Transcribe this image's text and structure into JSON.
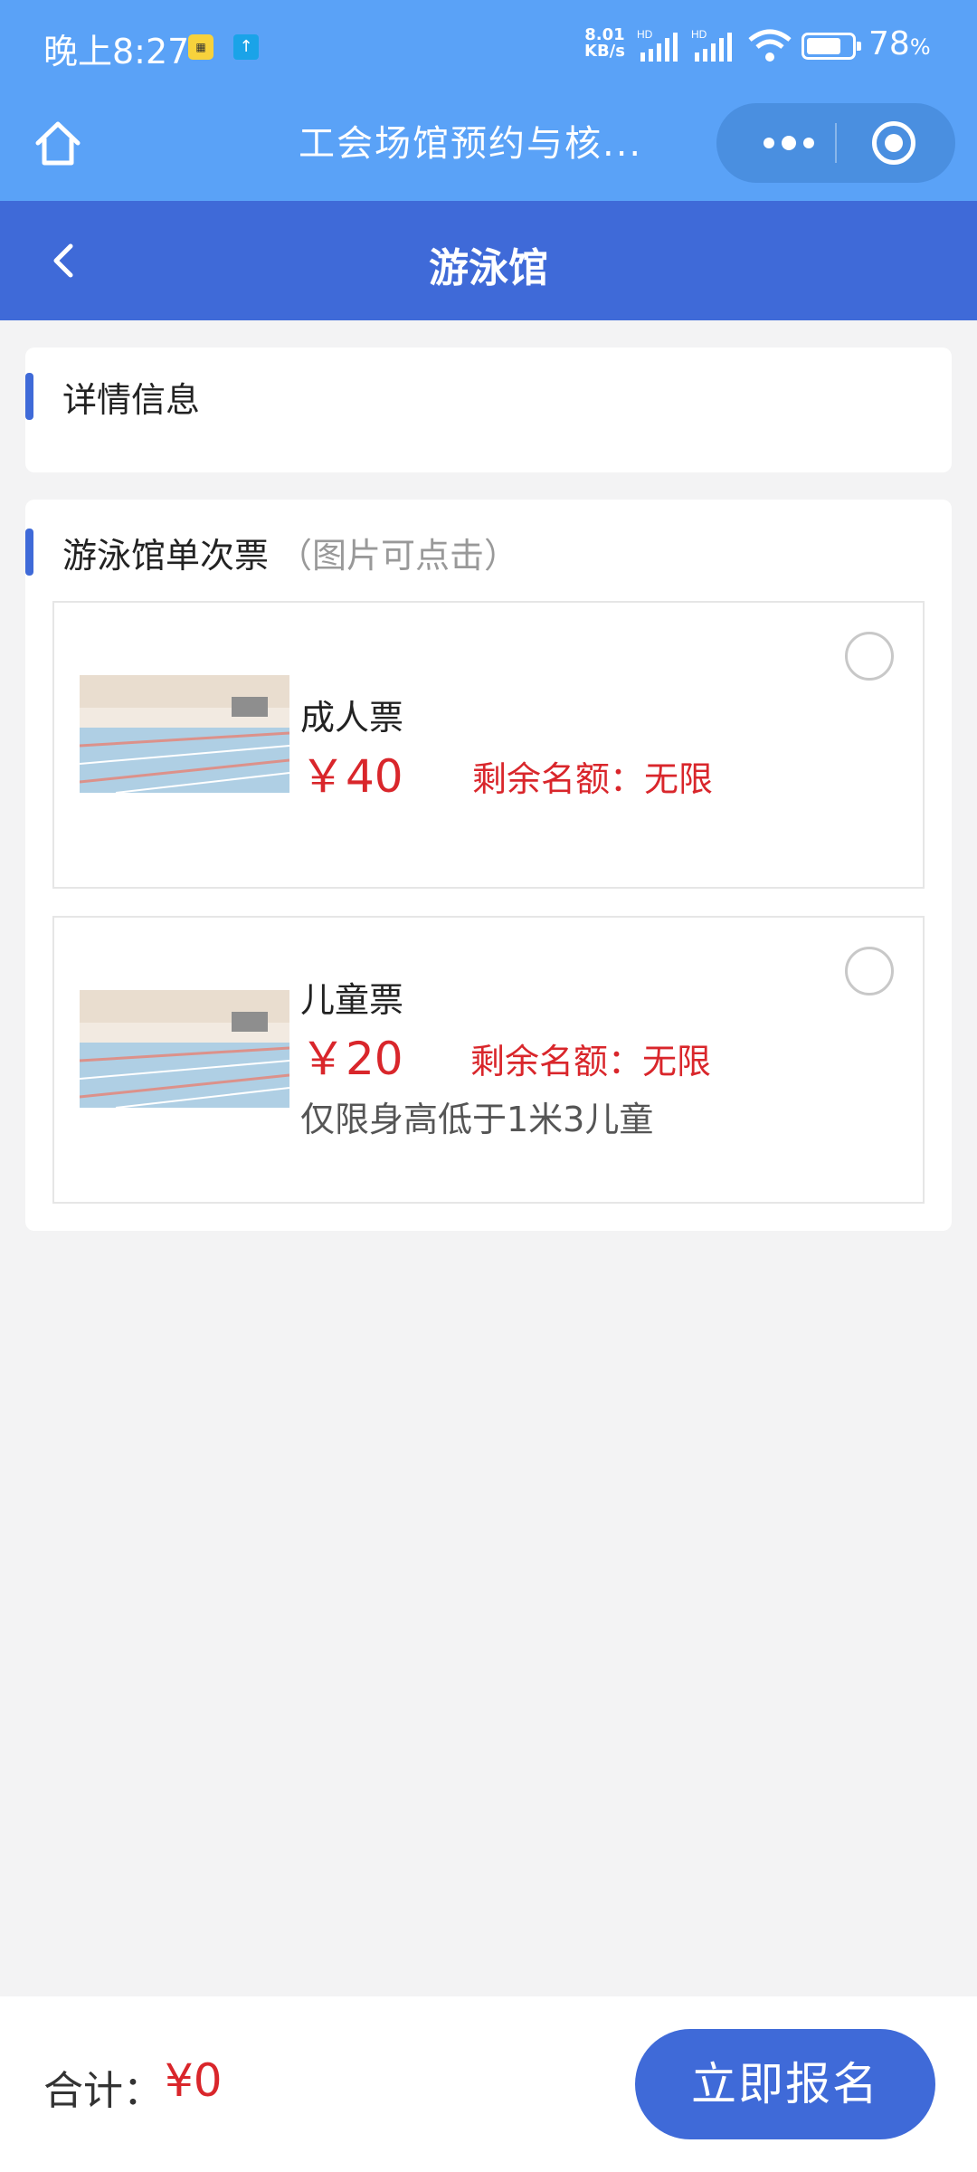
{
  "status_bar": {
    "time": "晚上8:27",
    "net_speed_value": "8.01",
    "net_speed_unit": "KB/s",
    "signal_label": "HD",
    "battery_percent_value": "78",
    "battery_percent_sign": "%",
    "battery_level": 0.78
  },
  "mini_program_bar": {
    "title": "工会场馆预约与核...",
    "icons": {
      "home": "home-icon",
      "more": "more-dots-icon",
      "close": "target-close-icon"
    }
  },
  "page_header": {
    "title": "游泳馆"
  },
  "details_section": {
    "title": "详情信息"
  },
  "tickets_section": {
    "title": "游泳馆单次票",
    "hint": "（图片可点击）",
    "tickets": [
      {
        "name": "成人票",
        "price": "￥40",
        "quota": "剩余名额：无限",
        "note": "",
        "selected": false
      },
      {
        "name": "儿童票",
        "price": "￥20",
        "quota": "剩余名额：无限",
        "note": "仅限身高低于1米3儿童",
        "selected": false
      }
    ]
  },
  "bottom_bar": {
    "total_label": "合计：",
    "total_value": "¥0",
    "signup_label": "立即报名"
  },
  "colors": {
    "status_bg": "#5aa2f7",
    "header_bg": "#3f6ad8",
    "accent": "#3f6ad8",
    "price_red": "#d9262b",
    "page_bg": "#f3f3f4"
  }
}
